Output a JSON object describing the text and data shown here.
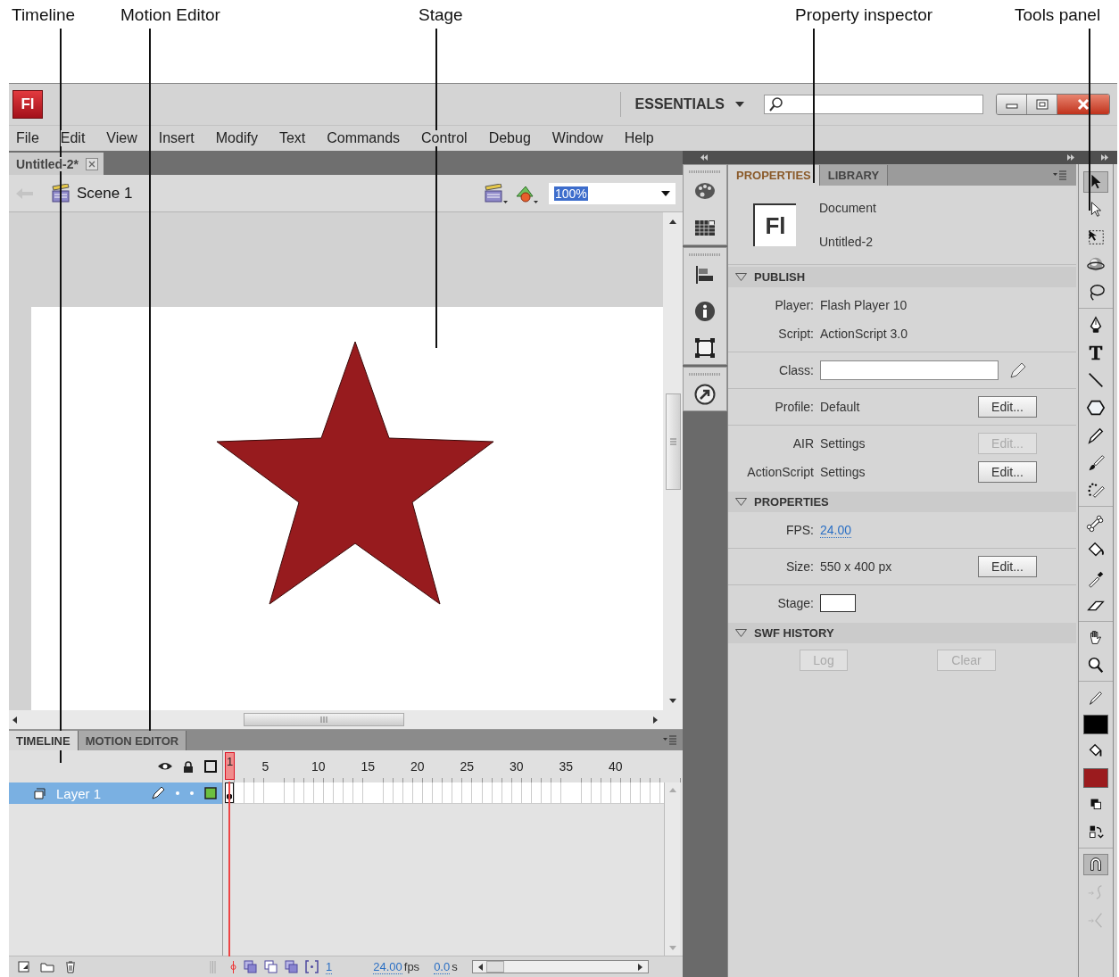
{
  "callouts": [
    {
      "label": "Timeline"
    },
    {
      "label": "Motion Editor"
    },
    {
      "label": "Stage"
    },
    {
      "label": "Property inspector"
    },
    {
      "label": "Tools panel"
    }
  ],
  "window": {
    "logo": "Fl",
    "workspace": "ESSENTIALS"
  },
  "menu": [
    "File",
    "Edit",
    "View",
    "Insert",
    "Modify",
    "Text",
    "Commands",
    "Control",
    "Debug",
    "Window",
    "Help"
  ],
  "document_tab": {
    "title": "Untitled-2*"
  },
  "edit_bar": {
    "scene": "Scene 1",
    "zoom": "100%"
  },
  "stage": {
    "shape": {
      "kind": "star",
      "color": "#971b1e"
    }
  },
  "timeline": {
    "tabs": [
      {
        "label": "TIMELINE",
        "selected": true
      },
      {
        "label": "MOTION EDITOR",
        "selected": false
      }
    ],
    "frame_numbers": [
      "1",
      "5",
      "10",
      "15",
      "20",
      "25",
      "30",
      "35",
      "40"
    ],
    "layers": [
      {
        "name": "Layer 1",
        "selected": true,
        "color": "#6cbf3f",
        "keyframe": true
      }
    ],
    "status": {
      "frame": "1",
      "fps": "24.00",
      "fps_unit": "fps",
      "time": "0.0",
      "time_unit": "s"
    }
  },
  "properties": {
    "tabs": [
      {
        "label": "PROPERTIES",
        "selected": true
      },
      {
        "label": "LIBRARY",
        "selected": false
      }
    ],
    "document": {
      "icon": "Fl",
      "type": "Document",
      "name": "Untitled-2"
    },
    "sections": [
      {
        "title": "PUBLISH",
        "expanded": true,
        "groups": [
          [
            {
              "kind": "text",
              "label": "Player:",
              "value": "Flash Player 10"
            },
            {
              "kind": "text",
              "label": "Script:",
              "value": "ActionScript 3.0"
            }
          ],
          [
            {
              "kind": "field",
              "label": "Class:"
            }
          ],
          [
            {
              "kind": "text",
              "label": "Profile:",
              "value": "Default",
              "button": {
                "label": "Edit...",
                "disabled": false
              }
            }
          ],
          [
            {
              "kind": "text",
              "label": "AIR",
              "value": "Settings",
              "button": {
                "label": "Edit...",
                "disabled": true
              }
            },
            {
              "kind": "text",
              "label": "ActionScript",
              "value": "Settings",
              "button": {
                "label": "Edit...",
                "disabled": false
              }
            }
          ]
        ]
      },
      {
        "title": "PROPERTIES",
        "expanded": true,
        "groups": [
          [
            {
              "kind": "link",
              "label": "FPS:",
              "value": "24.00"
            }
          ],
          [
            {
              "kind": "text",
              "label": "Size:",
              "value": "550 x 400 px",
              "button": {
                "label": "Edit...",
                "disabled": false
              }
            }
          ],
          [
            {
              "kind": "swatch",
              "label": "Stage:",
              "color": "#ffffff"
            }
          ]
        ]
      },
      {
        "title": "SWF HISTORY",
        "expanded": true,
        "groups": [
          [
            {
              "kind": "buttons",
              "buttons": [
                {
                  "label": "Log",
                  "disabled": true
                },
                {
                  "label": "Clear",
                  "disabled": true
                }
              ]
            }
          ]
        ]
      }
    ]
  },
  "tools": [
    [
      {
        "kind": "selection",
        "selected": true,
        "disabled": false
      },
      {
        "kind": "subselection",
        "selected": false,
        "disabled": false
      },
      {
        "kind": "free_transform",
        "selected": false,
        "disabled": false
      },
      {
        "kind": "rotation3d",
        "selected": false,
        "disabled": false
      },
      {
        "kind": "lasso",
        "selected": false,
        "disabled": false
      }
    ],
    [
      {
        "kind": "pen",
        "selected": false,
        "disabled": false
      },
      {
        "kind": "text",
        "selected": false,
        "disabled": false
      },
      {
        "kind": "line",
        "selected": false,
        "disabled": false
      },
      {
        "kind": "polygon",
        "selected": false,
        "disabled": false
      },
      {
        "kind": "pencil",
        "selected": false,
        "disabled": false
      },
      {
        "kind": "brush",
        "selected": false,
        "disabled": false
      },
      {
        "kind": "deco",
        "selected": false,
        "disabled": false
      }
    ],
    [
      {
        "kind": "bone",
        "selected": false,
        "disabled": false
      },
      {
        "kind": "bucket",
        "selected": false,
        "disabled": false
      },
      {
        "kind": "eyedropper",
        "selected": false,
        "disabled": false
      },
      {
        "kind": "eraser",
        "selected": false,
        "disabled": false
      }
    ],
    [
      {
        "kind": "hand",
        "selected": false,
        "disabled": false
      },
      {
        "kind": "zoom",
        "selected": false,
        "disabled": false
      }
    ],
    [
      {
        "kind": "stroke_pencil",
        "selected": false,
        "disabled": false
      },
      {
        "kind": "swatch",
        "color": "#000000",
        "selected": false,
        "disabled": false
      },
      {
        "kind": "fill_bucket",
        "selected": false,
        "disabled": false
      },
      {
        "kind": "swatch",
        "color": "#9b1b1e",
        "selected": false,
        "disabled": false
      },
      {
        "kind": "default_colors",
        "selected": false,
        "disabled": false
      },
      {
        "kind": "swap_colors",
        "selected": false,
        "disabled": false
      }
    ],
    [
      {
        "kind": "snap",
        "selected": true,
        "disabled": false
      },
      {
        "kind": "smooth",
        "selected": false,
        "disabled": true
      },
      {
        "kind": "straighten",
        "selected": false,
        "disabled": true
      }
    ]
  ]
}
